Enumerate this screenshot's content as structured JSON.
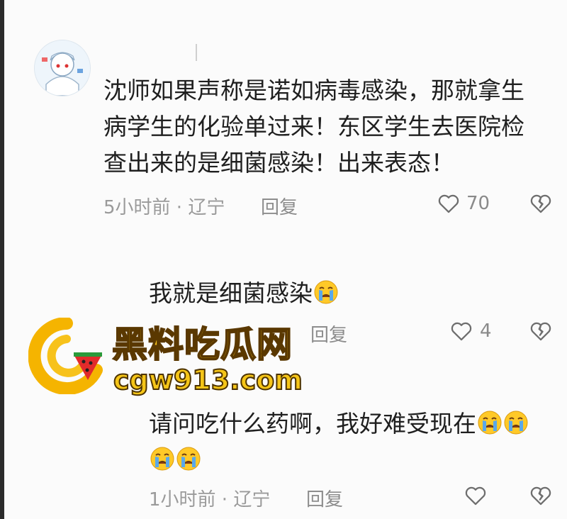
{
  "comment1": {
    "text_line1": "沈师如果声称是诺如病毒感染，那就拿生",
    "text_line2": "病学生的化验单过来！东区学生去医院检",
    "text_line3": "查出来的是细菌感染！出来表态！",
    "meta": "5小时前 · 辽宁",
    "reply_label": "回复",
    "like_count": "70"
  },
  "reply1": {
    "text": "我就是细菌感染",
    "emoji": "crying-face",
    "reply_label": "回复",
    "like_count": "4"
  },
  "reply2": {
    "text_line1": "请问吃什么药啊，我好难受现在",
    "emoji_count_line1": 2,
    "emoji_count_line2": 2,
    "meta": "1小时前 · 辽宁",
    "reply_label": "回复"
  },
  "watermark": {
    "title": "黑料吃瓜网",
    "url": "cgw913.com"
  },
  "colors": {
    "background": "#fbfbfb",
    "text": "#1f1f1f",
    "meta": "#9a9a9a",
    "watermark_yellow": "#f7c21b",
    "emoji_yellow": "#ffc928",
    "emoji_tear": "#5aa8ea"
  }
}
